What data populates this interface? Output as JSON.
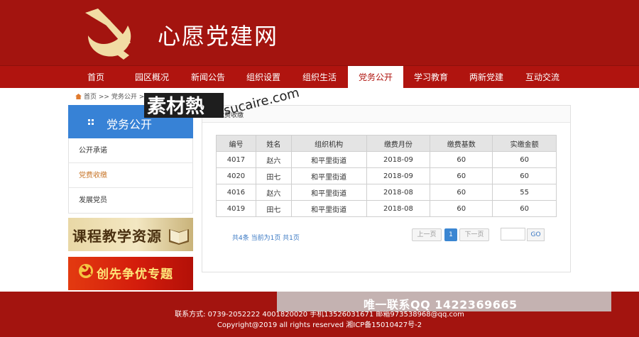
{
  "header": {
    "site_title": "心愿党建网"
  },
  "nav": {
    "items": [
      {
        "label": "首页"
      },
      {
        "label": "园区概况"
      },
      {
        "label": "新闻公告"
      },
      {
        "label": "组织设置"
      },
      {
        "label": "组织生活"
      },
      {
        "label": "党务公开",
        "active": true
      },
      {
        "label": "学习教育"
      },
      {
        "label": "两新党建"
      },
      {
        "label": "互动交流"
      }
    ]
  },
  "breadcrumb": {
    "home": "首页",
    "sep": ">>",
    "current": "党务公开",
    "sep2": ">>"
  },
  "sidebar": {
    "title": "党务公开",
    "items": [
      {
        "label": "公开承诺"
      },
      {
        "label": "党费收缴",
        "active": true
      },
      {
        "label": "发展党员"
      }
    ],
    "banner1": "课程教学资源",
    "banner2": "创先争优专题"
  },
  "panel": {
    "title": "党费收缴"
  },
  "table": {
    "headers": [
      "编号",
      "姓名",
      "组织机构",
      "缴费月份",
      "缴费基数",
      "实缴金额"
    ],
    "rows": [
      [
        "4017",
        "赵六",
        "和平里街道",
        "2018-09",
        "60",
        "60"
      ],
      [
        "4020",
        "田七",
        "和平里街道",
        "2018-09",
        "60",
        "60"
      ],
      [
        "4016",
        "赵六",
        "和平里街道",
        "2018-08",
        "60",
        "55"
      ],
      [
        "4019",
        "田七",
        "和平里街道",
        "2018-08",
        "60",
        "60"
      ]
    ]
  },
  "pager": {
    "info": "共4条 当前为1页 共1页",
    "prev": "上一页",
    "current": "1",
    "next": "下一页",
    "go": "GO"
  },
  "footer": {
    "contact": "联系方式: 0739-2052222 4001820020 手机13526031671 邮箱973538968@qq.com",
    "copyright": "Copyright@2019 all rights reserved 湘ICP备15010427号-2"
  },
  "watermark": {
    "cn": "素材熱",
    "en": "sucaire.com",
    "qq": "唯一联系QQ 1422369665"
  },
  "colors": {
    "brand_red": "#a3140f",
    "sidebar_blue": "#3782d6",
    "active_side": "#c8762a",
    "pager_blue": "#3b86d2"
  }
}
